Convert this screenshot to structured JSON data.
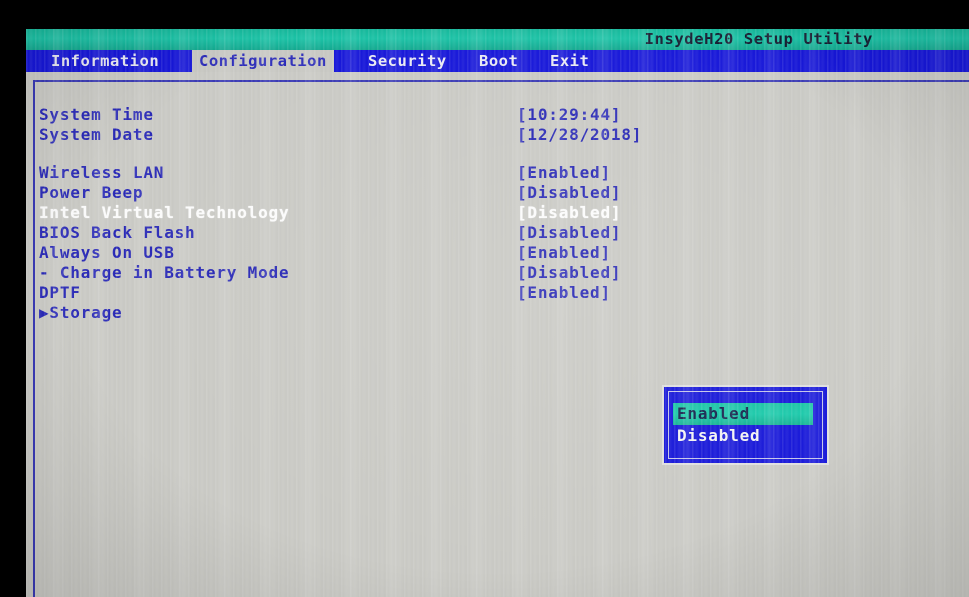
{
  "window": {
    "title": "InsydeH20 Setup Utility"
  },
  "menu": {
    "items": [
      {
        "label": "Information",
        "active": false
      },
      {
        "label": "Configuration",
        "active": true
      },
      {
        "label": "Security",
        "active": false
      },
      {
        "label": "Boot",
        "active": false
      },
      {
        "label": "Exit",
        "active": false
      }
    ]
  },
  "settings": [
    {
      "label": "System Time",
      "value": "[10:29:44]",
      "selected": false
    },
    {
      "label": "System Date",
      "value": "[12/28/2018]",
      "selected": false
    },
    {
      "label": "Wireless LAN",
      "value": "[Enabled]",
      "selected": false
    },
    {
      "label": "Power Beep",
      "value": "[Disabled]",
      "selected": false
    },
    {
      "label": "Intel Virtual Technology",
      "value": "[Disabled]",
      "selected": true
    },
    {
      "label": "BIOS Back Flash",
      "value": "[Disabled]",
      "selected": false
    },
    {
      "label": "Always On USB",
      "value": "[Enabled]",
      "selected": false
    },
    {
      "label": "- Charge in Battery Mode",
      "value": "[Disabled]",
      "selected": false
    },
    {
      "label": "DPTF",
      "value": "[Enabled]",
      "selected": false
    },
    {
      "label": "▶Storage",
      "value": "",
      "selected": false
    }
  ],
  "popup": {
    "options": [
      {
        "label": "Enabled",
        "highlighted": true
      },
      {
        "label": "Disabled",
        "highlighted": false
      }
    ]
  },
  "colors": {
    "title_band": "#1cc2a6",
    "menu_bar": "#1717d8",
    "screen_bg": "#c9c9c4",
    "text_blue": "#2a2ab6",
    "text_selected": "#fbfbfb",
    "popup_bg": "#1717d8",
    "popup_highlight": "#1bc9aa"
  }
}
